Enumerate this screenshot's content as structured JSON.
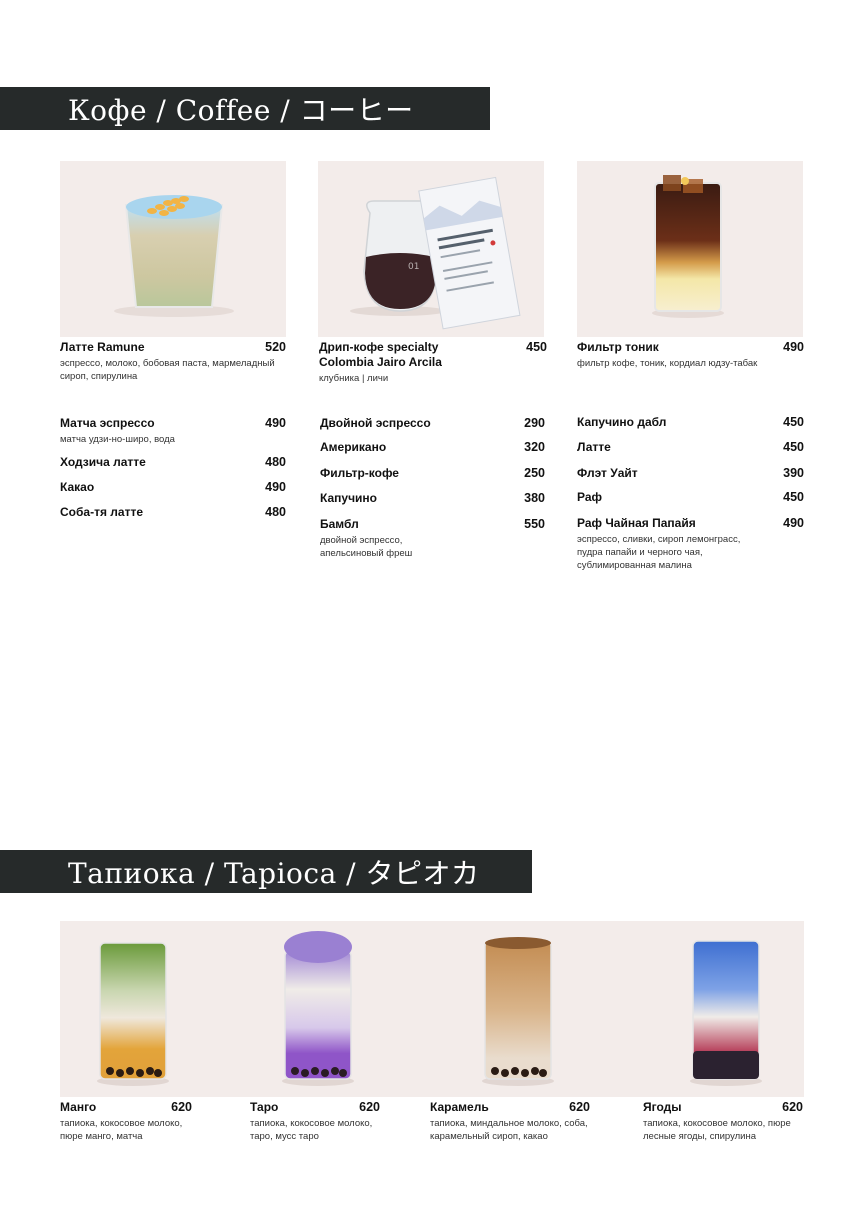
{
  "coffee": {
    "title": "Кофе / Coffee / コーヒー",
    "featured": [
      {
        "name": "Латте Ramune",
        "price": "520",
        "desc": "эспрессо, молоко, бобовая паста, мармеладный сироп, спирулина"
      },
      {
        "name": "Дрип-кофе specialty Colombia Jairo Arcila",
        "price": "450",
        "desc": "клубника | личи"
      },
      {
        "name": "Фильтр тоник",
        "price": "490",
        "desc": "фильтр кофе, тоник, кордиал юдзу-табак"
      }
    ],
    "drip_card": {
      "title": "COLOMBIA JAIRO ARCILA CASTILLO",
      "number": "01"
    },
    "col1": [
      {
        "name": "Матча эспрессо",
        "price": "490",
        "desc": "матча удзи-но-широ, вода"
      },
      {
        "name": "Ходзича латте",
        "price": "480",
        "desc": ""
      },
      {
        "name": "Какао",
        "price": "490",
        "desc": ""
      },
      {
        "name": "Соба-тя латте",
        "price": "480",
        "desc": ""
      }
    ],
    "col2": [
      {
        "name": "Двойной эспрессо",
        "price": "290",
        "desc": ""
      },
      {
        "name": "Американо",
        "price": "320",
        "desc": ""
      },
      {
        "name": "Фильтр-кофе",
        "price": "250",
        "desc": ""
      },
      {
        "name": "Капучино",
        "price": "380",
        "desc": ""
      },
      {
        "name": "Бамбл",
        "price": "550",
        "desc": "двойной эспрессо, апельсиновый фреш"
      }
    ],
    "col3": [
      {
        "name": "Капучино дабл",
        "price": "450",
        "desc": ""
      },
      {
        "name": "Латте",
        "price": "450",
        "desc": ""
      },
      {
        "name": "Флэт Уайт",
        "price": "390",
        "desc": ""
      },
      {
        "name": "Раф",
        "price": "450",
        "desc": ""
      },
      {
        "name": "Раф Чайная Папайя",
        "price": "490",
        "desc": "эспрессо, сливки, сироп лемонграсс, пудра папайи и черного чая, сублимированная малина"
      }
    ]
  },
  "tapioca": {
    "title": "Тапиока / Tapioca / タピオカ",
    "items": [
      {
        "name": "Манго",
        "price": "620",
        "desc": "тапиока, кокосовое молоко, пюре манго, матча"
      },
      {
        "name": "Таро",
        "price": "620",
        "desc": "тапиока, кокосовое молоко, таро, мусс таро"
      },
      {
        "name": "Карамель",
        "price": "620",
        "desc": "тапиока, миндальное молоко, соба, карамельный сироп, какао"
      },
      {
        "name": "Ягоды",
        "price": "620",
        "desc": "тапиока, кокосовое молоко, пюре лесные ягоды, спирулина"
      }
    ]
  },
  "colors": {
    "band": "#262a2a",
    "photo_bg": "#f3ecea"
  }
}
